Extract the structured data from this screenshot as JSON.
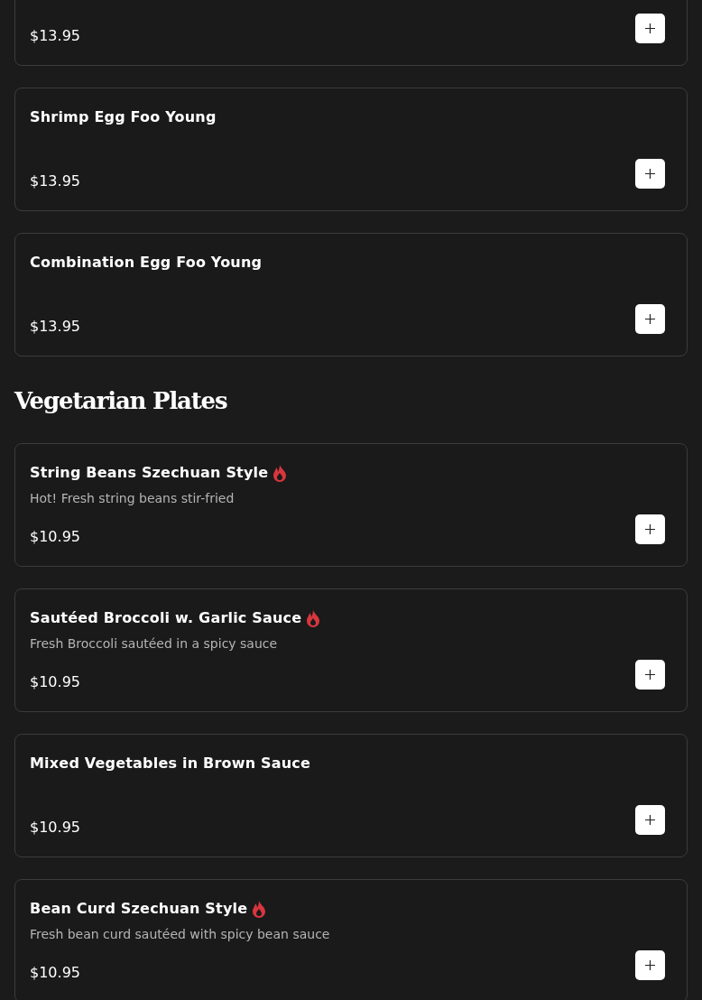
{
  "sections": [
    {
      "items": [
        {
          "price": "$13.95"
        },
        {
          "name": "Shrimp Egg Foo Young",
          "spicy": false,
          "price": "$13.95"
        },
        {
          "name": "Combination Egg Foo Young",
          "spicy": false,
          "price": "$13.95"
        }
      ]
    },
    {
      "title": "Vegetarian Plates",
      "items": [
        {
          "name": "String Beans Szechuan Style",
          "spicy": true,
          "description": "Hot! Fresh string beans stir-fried",
          "price": "$10.95"
        },
        {
          "name": "Sautéed Broccoli w. Garlic Sauce",
          "spicy": true,
          "description": "Fresh Broccoli sautéed in a spicy sauce",
          "price": "$10.95"
        },
        {
          "name": "Mixed Vegetables in Brown Sauce",
          "spicy": false,
          "price": "$10.95"
        },
        {
          "name": "Bean Curd Szechuan Style",
          "spicy": true,
          "description": "Fresh bean curd sautéed with spicy bean sauce",
          "price": "$10.95"
        }
      ]
    }
  ]
}
